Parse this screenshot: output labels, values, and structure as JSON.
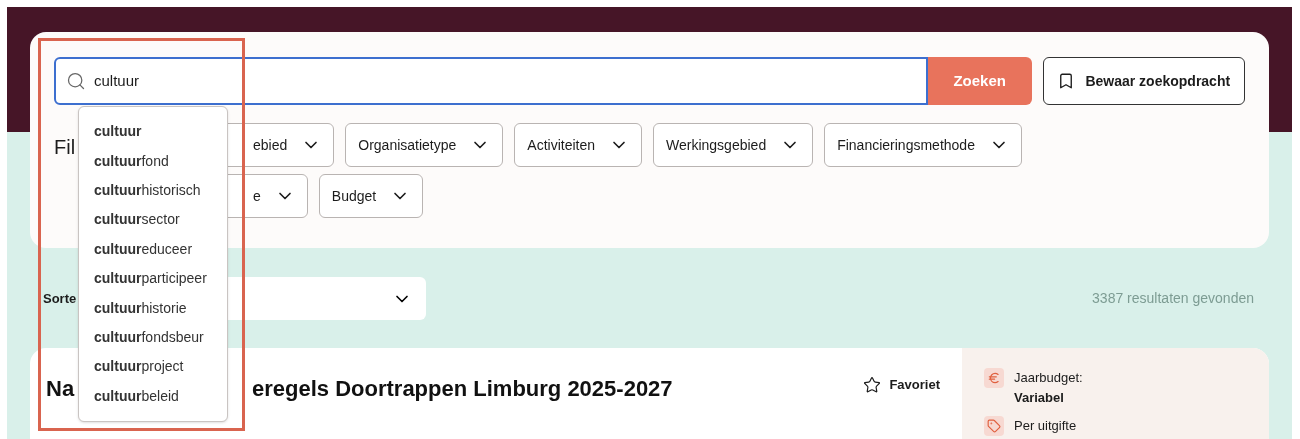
{
  "search": {
    "value": "cultuur",
    "button": "Zoeken",
    "save_button": "Bewaar zoekopdracht"
  },
  "filters": {
    "label": "Fil",
    "rows": [
      [
        "ebied",
        "Organisatietype",
        "Activiteiten",
        "Werkingsgebied",
        "Financieringsmethode"
      ],
      [
        "e",
        "Budget"
      ]
    ]
  },
  "suggestions": [
    "**cultuur**",
    "**cultuur**fond",
    "**cultuur**historisch",
    "**cultuur**sector",
    "**cultuur**educeer",
    "**cultuur**participeer",
    "**cultuur**historie",
    "**cultuur**fondsbeur",
    "**cultuur**project",
    "**cultuur**beleid"
  ],
  "sort": {
    "label": "Sorte"
  },
  "result_count": "3387 resultaten gevonden",
  "result": {
    "title_parts": [
      "Na",
      "eregels Doortrappen Limburg 2025-2027"
    ],
    "favorite": "Favoriet",
    "facts": [
      {
        "kind": "euro",
        "label": "Jaarbudget:",
        "value": "Variabel"
      },
      {
        "kind": "tag",
        "label": "Per uitgifte"
      }
    ]
  }
}
